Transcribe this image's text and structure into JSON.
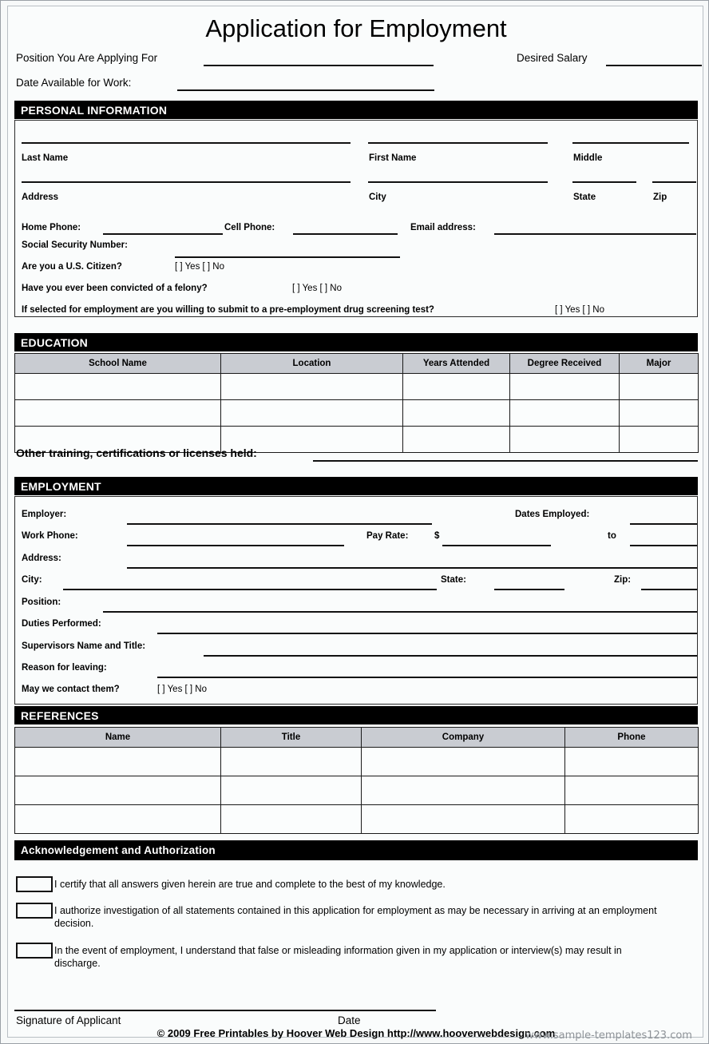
{
  "document": {
    "title": "Application for Employment"
  },
  "top_fields": {
    "position_label": "Position You Are Applying For",
    "desired_salary_label": "Desired Salary",
    "date_available_label": "Date Available for Work:"
  },
  "sections": {
    "personal": "PERSONAL INFORMATION",
    "education": "EDUCATION",
    "employment": "EMPLOYMENT",
    "references": "REFERENCES",
    "acknowledgement": "Acknowledgement and Authorization"
  },
  "personal": {
    "last_name": "Last Name",
    "first_name": "First Name",
    "middle": "Middle",
    "address": "Address",
    "city": "City",
    "state": "State",
    "zip": "Zip",
    "home_phone": "Home Phone:",
    "cell_phone": "Cell Phone:",
    "email": "Email address:",
    "ssn": "Social Security Number:",
    "citizen_question": "Are you a U.S. Citizen?",
    "citizen_options": "[ ] Yes [ ] No",
    "felony_question": "Have you ever been convicted of a felony?",
    "felony_options": "[ ] Yes [ ] No",
    "drug_question": "If selected for employment are you willing to submit to a pre-employment drug screening test?",
    "drug_options": "[ ] Yes [ ] No"
  },
  "education": {
    "columns": [
      "School Name",
      "Location",
      "Years Attended",
      "Degree Received",
      "Major"
    ],
    "rows": [
      [
        "",
        "",
        "",
        "",
        ""
      ],
      [
        "",
        "",
        "",
        "",
        ""
      ],
      [
        "",
        "",
        "",
        "",
        ""
      ]
    ],
    "other_training_label": "Other training, certifications or licenses held:"
  },
  "employment": {
    "employer": "Employer:",
    "dates_employed": "Dates Employed:",
    "work_phone": "Work Phone:",
    "pay_rate": "Pay Rate:",
    "dollar_sign": "$",
    "to": "to",
    "address": "Address:",
    "city": "City:",
    "state": "State:",
    "zip": "Zip:",
    "position": "Position:",
    "duties": "Duties Performed:",
    "supervisor": "Supervisors Name and Title:",
    "reason": "Reason for leaving:",
    "contact_question": "May we contact them?",
    "contact_options": "[ ] Yes [ ] No"
  },
  "references": {
    "columns": [
      "Name",
      "Title",
      "Company",
      "Phone"
    ],
    "rows": [
      [
        "",
        "",
        "",
        ""
      ],
      [
        "",
        "",
        "",
        ""
      ],
      [
        "",
        "",
        "",
        ""
      ]
    ]
  },
  "acknowledgement": {
    "items": [
      "I certify that all answers given herein are true and complete to the best of my knowledge.",
      "I authorize investigation of all statements contained in this application for employment as may be necessary in arriving at an employment decision.",
      "In the event of employment, I understand that false or misleading information given in my application or interview(s) may result in discharge."
    ]
  },
  "signature": {
    "signature_label": "Signature of  Applicant",
    "date_label": "Date"
  },
  "footer": {
    "copyright": "© 2009 Free Printables by Hoover Web Design http://www.hooverwebdesign.com",
    "watermark": "www.sample-templates123.com"
  }
}
